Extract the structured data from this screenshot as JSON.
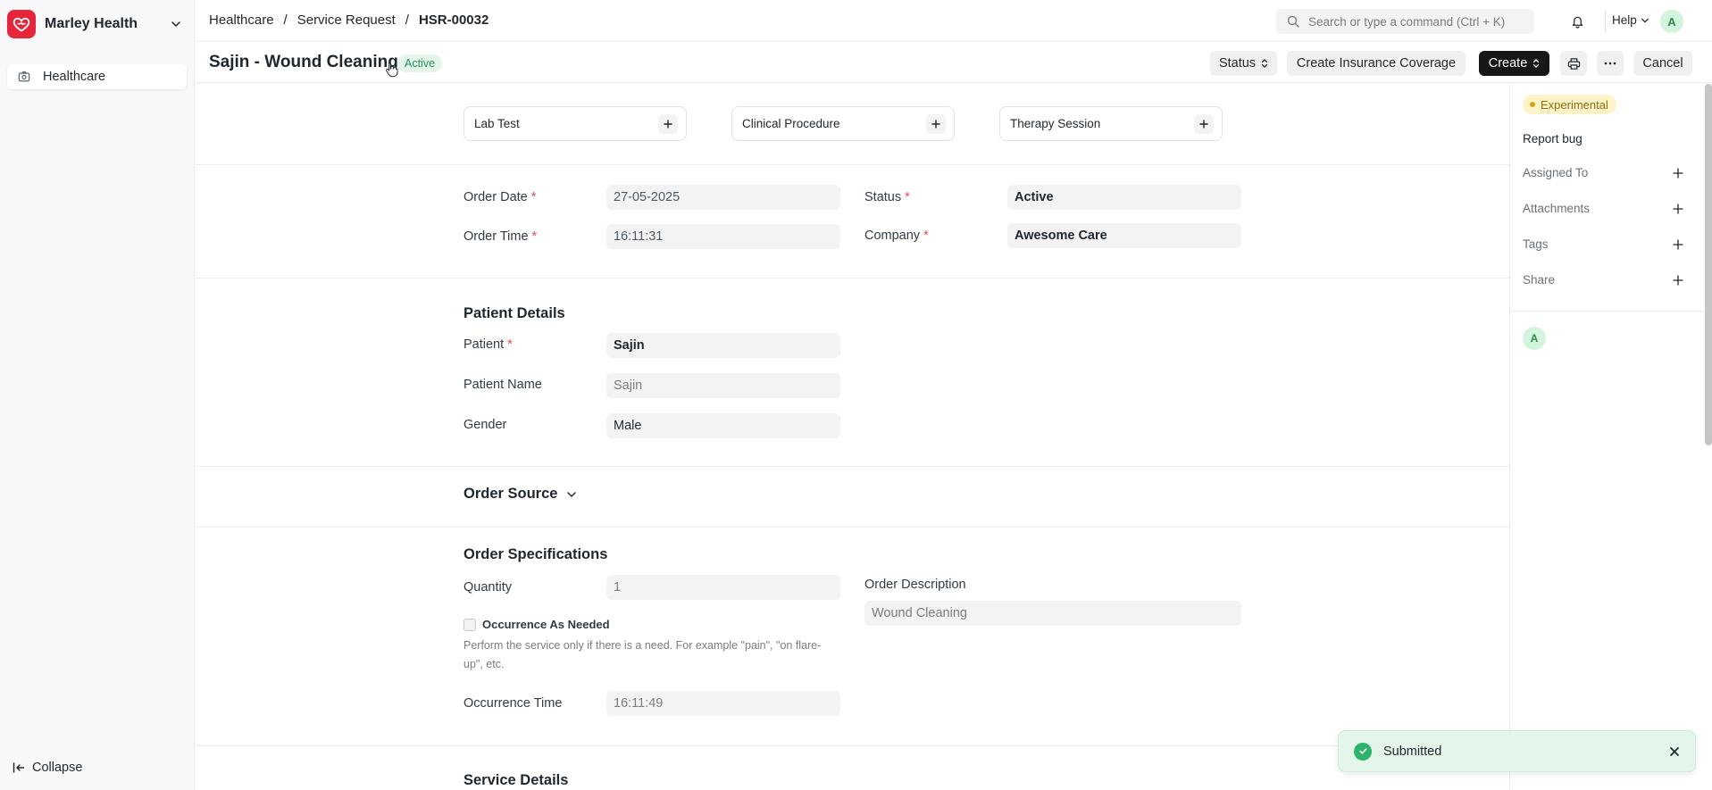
{
  "sidebar": {
    "brand": "Marley Health",
    "items": [
      {
        "label": "Healthcare"
      }
    ],
    "collapse_label": "Collapse"
  },
  "topbar": {
    "breadcrumbs": [
      "Healthcare",
      "Service Request",
      "HSR-00032"
    ],
    "search_placeholder": "Search or type a command (Ctrl + K)",
    "help_label": "Help",
    "user_initial": "A"
  },
  "header": {
    "title": "Sajin - Wound Cleaning",
    "status_badge": "Active",
    "buttons": {
      "status": "Status",
      "insurance": "Create Insurance Coverage",
      "create": "Create",
      "cancel": "Cancel"
    }
  },
  "links": [
    {
      "label": "Lab Test"
    },
    {
      "label": "Clinical Procedure"
    },
    {
      "label": "Therapy Session"
    }
  ],
  "order": {
    "order_date_label": "Order Date",
    "order_date": "27-05-2025",
    "order_time_label": "Order Time",
    "order_time": "16:11:31",
    "status_label": "Status",
    "status": "Active",
    "company_label": "Company",
    "company": "Awesome Care"
  },
  "patient_details": {
    "title": "Patient Details",
    "patient_label": "Patient",
    "patient": "Sajin",
    "patient_name_label": "Patient Name",
    "patient_name": "Sajin",
    "gender_label": "Gender",
    "gender": "Male"
  },
  "order_source": {
    "title": "Order Source"
  },
  "order_specifications": {
    "title": "Order Specifications",
    "quantity_label": "Quantity",
    "quantity": "1",
    "occurrence_as_needed_label": "Occurrence As Needed",
    "occurrence_as_needed_checked": false,
    "occurrence_desc": "Perform the service only if there is a need. For example \"pain\", \"on flare-up\", etc.",
    "occurrence_time_label": "Occurrence Time",
    "occurrence_time": "16:11:49",
    "order_description_label": "Order Description",
    "order_description": "Wound Cleaning"
  },
  "service_details": {
    "title": "Service Details"
  },
  "right_sidebar": {
    "experimental": "Experimental",
    "report_bug": "Report bug",
    "assigned_to": "Assigned To",
    "attachments": "Attachments",
    "tags": "Tags",
    "share": "Share",
    "user_initial": "A"
  },
  "toast": {
    "message": "Submitted"
  },
  "colors": {
    "brand": "#e5263a",
    "success": "#2db36b",
    "required": "#e24c4c",
    "primary_button": "#171717"
  }
}
